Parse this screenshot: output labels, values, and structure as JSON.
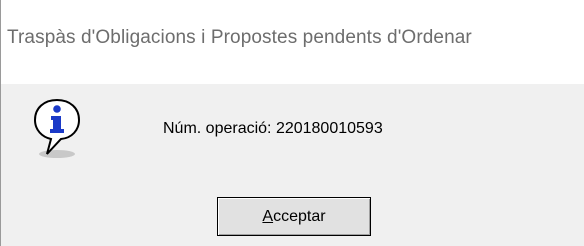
{
  "window": {
    "title": "Traspàs d'Obligacions i Propostes pendents d'Ordenar"
  },
  "message": {
    "icon": "info-icon",
    "text": "Núm. operació: 220180010593"
  },
  "button": {
    "accelerator": "A",
    "rest": "cceptar"
  },
  "colors": {
    "title_text": "#6d6d6d",
    "icon_blue": "#1b3ac8",
    "dialog_bg": "#f0f0f0"
  }
}
